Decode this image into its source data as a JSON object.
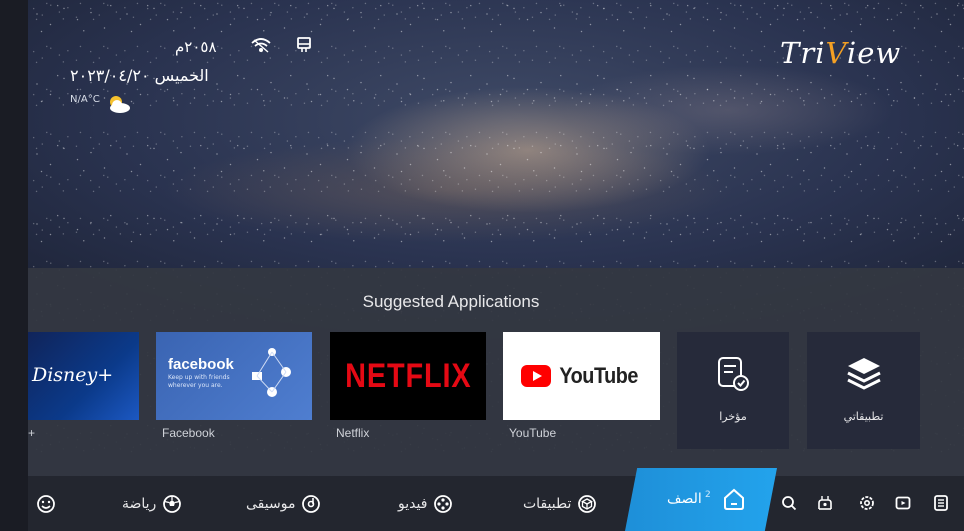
{
  "status": {
    "time": "٢٠٥٨م",
    "date": "الخميس ٢٠٢٣/٠٤/٢٠",
    "temperature": "N/A°C",
    "icons": [
      "wifi-icon",
      "usb-icon",
      "cloud-icon"
    ]
  },
  "brand": {
    "prefix": "Tri",
    "accent": "V",
    "suffix": "iew",
    "accent_color": "#f4a024"
  },
  "suggested": {
    "title": "Suggested Applications",
    "apps": [
      {
        "name": "Disney+",
        "caption": "+",
        "logo": "Disney+"
      },
      {
        "name": "Facebook",
        "caption": "Facebook",
        "logo": "facebook",
        "tagline": "Keep up with friends wherever you are."
      },
      {
        "name": "Netflix",
        "caption": "Netflix",
        "logo": "NETFLIX"
      },
      {
        "name": "YouTube",
        "caption": "YouTube",
        "logo": "YouTube"
      }
    ],
    "recent_label": "مؤخرا",
    "myapps_label": "تطبيقاتي"
  },
  "nav": {
    "items": [
      {
        "label": "رياضة",
        "icon": "soccer-ball-icon"
      },
      {
        "label": "موسيقى",
        "icon": "music-disc-icon"
      },
      {
        "label": "فيديو",
        "icon": "film-reel-icon"
      },
      {
        "label": "تطبيقات",
        "icon": "cube-icon"
      }
    ],
    "home_label": "الصف",
    "home_dot": "2",
    "colors": {
      "active": "#1e8fd8",
      "bar": "#23262f"
    }
  }
}
